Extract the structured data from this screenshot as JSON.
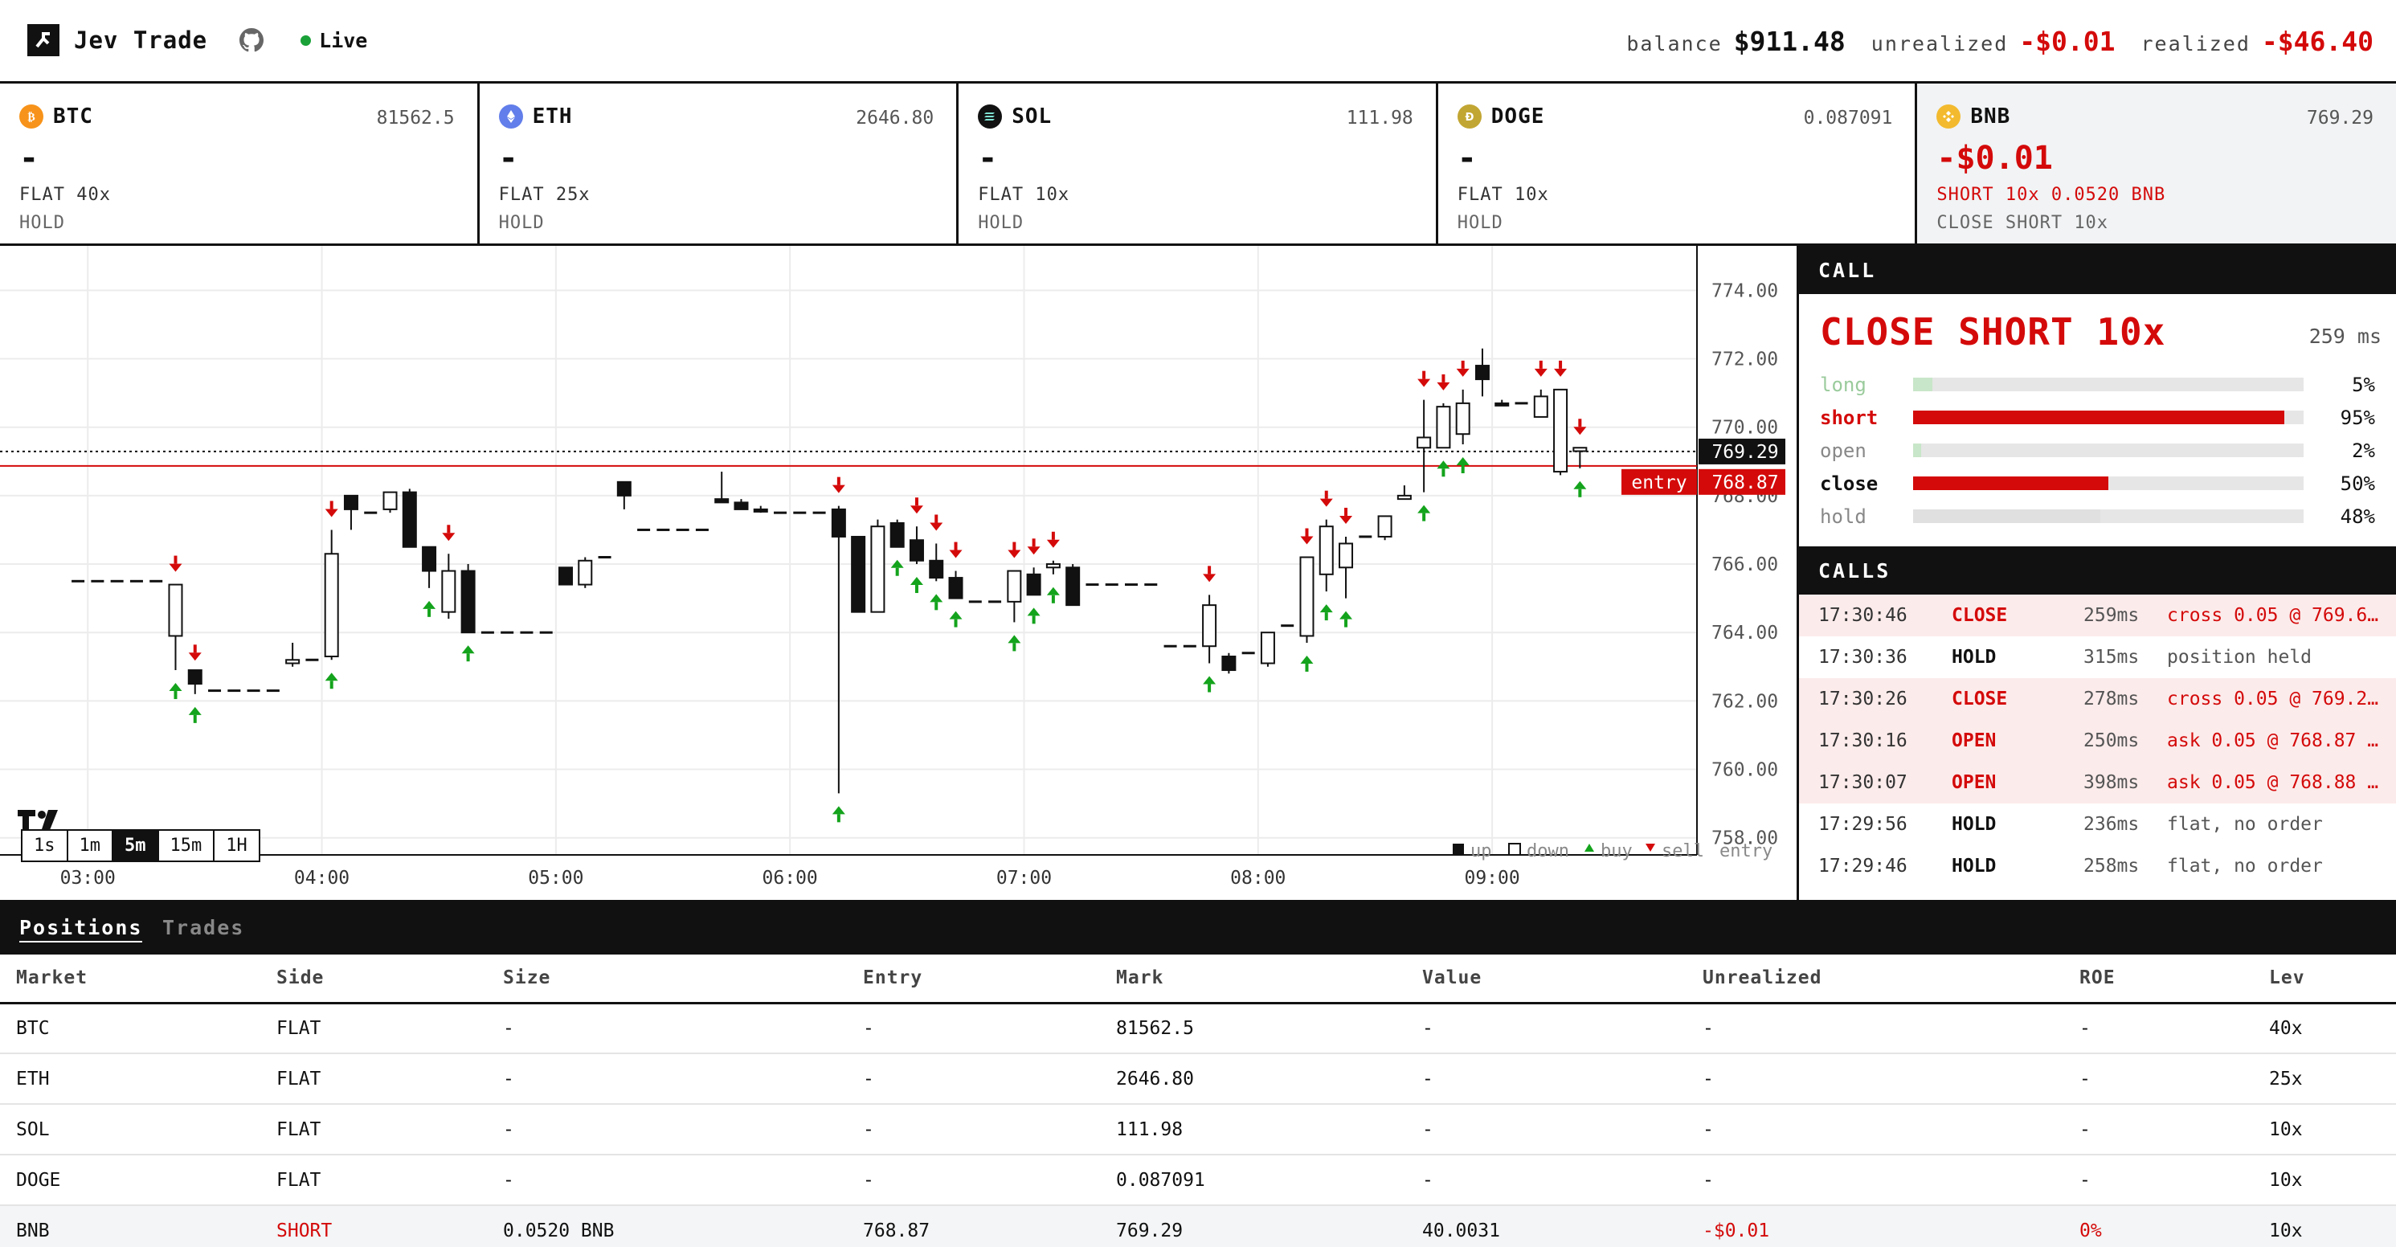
{
  "app": {
    "name": "Jev Trade",
    "status": "Live",
    "status_color": "#1aa138",
    "github_icon": "github-icon"
  },
  "header": {
    "balance_label": "balance",
    "balance_value": "$911.48",
    "unrealized_label": "unrealized",
    "unrealized_value": "-$0.01",
    "realized_label": "realized",
    "realized_value": "-$46.40"
  },
  "markets": [
    {
      "symbol": "BTC",
      "price": "81562.5",
      "pnl": "-",
      "position": "FLAT 40x",
      "action": "HOLD",
      "icon_color": "#f7931a",
      "icon": "bitcoin-icon"
    },
    {
      "symbol": "ETH",
      "price": "2646.80",
      "pnl": "-",
      "position": "FLAT 25x",
      "action": "HOLD",
      "icon_color": "#627eea",
      "icon": "ethereum-icon"
    },
    {
      "symbol": "SOL",
      "price": "111.98",
      "pnl": "-",
      "position": "FLAT 10x",
      "action": "HOLD",
      "icon_color": "#111111",
      "icon": "solana-icon"
    },
    {
      "symbol": "DOGE",
      "price": "0.087091",
      "pnl": "-",
      "position": "FLAT 10x",
      "action": "HOLD",
      "icon_color": "#c2a633",
      "icon": "dogecoin-icon"
    },
    {
      "symbol": "BNB",
      "price": "769.29",
      "pnl": "-$0.01",
      "position": "SHORT 10x 0.0520 BNB",
      "action": "CLOSE SHORT 10x",
      "icon_color": "#f3ba2f",
      "icon": "bnb-icon"
    }
  ],
  "chart": {
    "timeframes": [
      "1s",
      "1m",
      "5m",
      "15m",
      "1H"
    ],
    "active_timeframe": "5m",
    "legend": {
      "up": "up",
      "down": "down",
      "buy": "buy",
      "sell": "sell",
      "entry": "entry"
    },
    "current_price_label": "769.29",
    "entry_tag": "entry",
    "entry_price_label": "768.87"
  },
  "chart_data": {
    "type": "candlestick",
    "symbol": "BNB",
    "interval": "5m",
    "ylim": [
      757.5,
      775.3
    ],
    "y_ticks": [
      "758.00",
      "760.00",
      "762.00",
      "764.00",
      "766.00",
      "768.00",
      "770.00",
      "772.00",
      "774.00"
    ],
    "x_ticks": [
      "03:00",
      "04:00",
      "05:00",
      "06:00",
      "07:00",
      "08:00",
      "09:00"
    ],
    "last_price": 769.29,
    "entry_price": 768.87,
    "candles": [
      {
        "t": 1,
        "o": 765.5,
        "h": 765.5,
        "l": 765.5,
        "c": 765.5
      },
      {
        "t": 2,
        "o": 765.5,
        "h": 765.5,
        "l": 765.5,
        "c": 765.5
      },
      {
        "t": 3,
        "o": 765.5,
        "h": 765.5,
        "l": 765.5,
        "c": 765.5
      },
      {
        "t": 4,
        "o": 765.5,
        "h": 765.5,
        "l": 765.5,
        "c": 765.5
      },
      {
        "t": 5,
        "o": 765.5,
        "h": 765.5,
        "l": 765.5,
        "c": 765.5
      },
      {
        "t": 6,
        "o": 765.4,
        "h": 765.4,
        "l": 762.9,
        "c": 763.9,
        "sig": "both"
      },
      {
        "t": 7,
        "o": 762.5,
        "h": 762.8,
        "l": 762.2,
        "c": 762.9,
        "sig": "both"
      },
      {
        "t": 8,
        "o": 762.3,
        "h": 762.3,
        "l": 762.3,
        "c": 762.3
      },
      {
        "t": 9,
        "o": 762.3,
        "h": 762.3,
        "l": 762.3,
        "c": 762.3
      },
      {
        "t": 10,
        "o": 762.3,
        "h": 762.3,
        "l": 762.3,
        "c": 762.3
      },
      {
        "t": 11,
        "o": 762.3,
        "h": 762.3,
        "l": 762.3,
        "c": 762.3
      },
      {
        "t": 12,
        "o": 763.2,
        "h": 763.7,
        "l": 763.0,
        "c": 763.1
      },
      {
        "t": 13,
        "o": 763.2,
        "h": 763.2,
        "l": 763.2,
        "c": 763.2
      },
      {
        "t": 14,
        "o": 766.3,
        "h": 767.0,
        "l": 763.2,
        "c": 763.3,
        "sig": "both"
      },
      {
        "t": 15,
        "o": 767.6,
        "h": 767.9,
        "l": 767.0,
        "c": 768.0
      },
      {
        "t": 16,
        "o": 767.5,
        "h": 767.5,
        "l": 767.5,
        "c": 767.5
      },
      {
        "t": 17,
        "o": 768.1,
        "h": 768.1,
        "l": 767.5,
        "c": 767.6
      },
      {
        "t": 18,
        "o": 766.5,
        "h": 768.2,
        "l": 766.5,
        "c": 768.1
      },
      {
        "t": 19,
        "o": 765.8,
        "h": 766.4,
        "l": 765.3,
        "c": 766.5,
        "sig": "buy"
      },
      {
        "t": 20,
        "o": 765.8,
        "h": 766.3,
        "l": 764.4,
        "c": 764.6,
        "sig": "sell"
      },
      {
        "t": 21,
        "o": 764.0,
        "h": 766.0,
        "l": 764.0,
        "c": 765.8,
        "sig": "buy"
      },
      {
        "t": 22,
        "o": 764.0,
        "h": 764.0,
        "l": 764.0,
        "c": 764.0
      },
      {
        "t": 23,
        "o": 764.0,
        "h": 764.0,
        "l": 764.0,
        "c": 764.0
      },
      {
        "t": 24,
        "o": 764.0,
        "h": 764.0,
        "l": 764.0,
        "c": 764.0
      },
      {
        "t": 25,
        "o": 764.0,
        "h": 764.0,
        "l": 764.0,
        "c": 764.0
      },
      {
        "t": 26,
        "o": 765.4,
        "h": 765.9,
        "l": 765.4,
        "c": 765.9
      },
      {
        "t": 27,
        "o": 766.1,
        "h": 766.2,
        "l": 765.3,
        "c": 765.4
      },
      {
        "t": 28,
        "o": 766.2,
        "h": 766.2,
        "l": 766.2,
        "c": 766.2
      },
      {
        "t": 29,
        "o": 768.0,
        "h": 768.4,
        "l": 767.6,
        "c": 768.4
      },
      {
        "t": 30,
        "o": 767.0,
        "h": 767.0,
        "l": 767.0,
        "c": 767.0
      },
      {
        "t": 31,
        "o": 767.0,
        "h": 767.0,
        "l": 767.0,
        "c": 767.0
      },
      {
        "t": 32,
        "o": 767.0,
        "h": 767.0,
        "l": 767.0,
        "c": 767.0
      },
      {
        "t": 33,
        "o": 767.0,
        "h": 767.0,
        "l": 767.0,
        "c": 767.0
      },
      {
        "t": 34,
        "o": 767.8,
        "h": 768.7,
        "l": 767.8,
        "c": 767.9
      },
      {
        "t": 35,
        "o": 767.6,
        "h": 767.9,
        "l": 767.6,
        "c": 767.8
      },
      {
        "t": 36,
        "o": 767.6,
        "h": 767.7,
        "l": 767.5,
        "c": 767.6
      },
      {
        "t": 37,
        "o": 767.5,
        "h": 767.5,
        "l": 767.5,
        "c": 767.5
      },
      {
        "t": 38,
        "o": 767.5,
        "h": 767.5,
        "l": 767.5,
        "c": 767.5
      },
      {
        "t": 39,
        "o": 767.5,
        "h": 767.5,
        "l": 767.5,
        "c": 767.5
      },
      {
        "t": 40,
        "o": 766.8,
        "h": 767.7,
        "l": 759.3,
        "c": 767.6,
        "sig": "both"
      },
      {
        "t": 41,
        "o": 764.6,
        "h": 766.8,
        "l": 764.6,
        "c": 766.8
      },
      {
        "t": 42,
        "o": 767.1,
        "h": 767.3,
        "l": 764.6,
        "c": 764.6
      },
      {
        "t": 43,
        "o": 766.5,
        "h": 767.3,
        "l": 766.5,
        "c": 767.2,
        "sig": "buy"
      },
      {
        "t": 44,
        "o": 766.1,
        "h": 767.1,
        "l": 766.0,
        "c": 766.7,
        "sig": "both"
      },
      {
        "t": 45,
        "o": 765.6,
        "h": 766.6,
        "l": 765.5,
        "c": 766.1,
        "sig": "both"
      },
      {
        "t": 46,
        "o": 765.0,
        "h": 765.8,
        "l": 765.0,
        "c": 765.6,
        "sig": "both"
      },
      {
        "t": 47,
        "o": 764.9,
        "h": 764.9,
        "l": 764.9,
        "c": 764.9
      },
      {
        "t": 48,
        "o": 764.9,
        "h": 764.9,
        "l": 764.9,
        "c": 764.9
      },
      {
        "t": 49,
        "o": 765.8,
        "h": 765.8,
        "l": 764.3,
        "c": 764.9,
        "sig": "both"
      },
      {
        "t": 50,
        "o": 765.1,
        "h": 765.9,
        "l": 765.1,
        "c": 765.7,
        "sig": "both"
      },
      {
        "t": 51,
        "o": 766.0,
        "h": 766.1,
        "l": 765.7,
        "c": 765.9,
        "sig": "both"
      },
      {
        "t": 52,
        "o": 764.8,
        "h": 766.0,
        "l": 764.8,
        "c": 765.9
      },
      {
        "t": 53,
        "o": 765.4,
        "h": 765.4,
        "l": 765.4,
        "c": 765.4
      },
      {
        "t": 54,
        "o": 765.4,
        "h": 765.4,
        "l": 765.4,
        "c": 765.4
      },
      {
        "t": 55,
        "o": 765.4,
        "h": 765.4,
        "l": 765.4,
        "c": 765.4
      },
      {
        "t": 56,
        "o": 765.4,
        "h": 765.4,
        "l": 765.4,
        "c": 765.4
      },
      {
        "t": 57,
        "o": 763.6,
        "h": 763.6,
        "l": 763.6,
        "c": 763.6
      },
      {
        "t": 58,
        "o": 763.6,
        "h": 763.6,
        "l": 763.6,
        "c": 763.6
      },
      {
        "t": 59,
        "o": 764.8,
        "h": 765.1,
        "l": 763.1,
        "c": 763.6,
        "sig": "both"
      },
      {
        "t": 60,
        "o": 762.9,
        "h": 763.4,
        "l": 762.8,
        "c": 763.3
      },
      {
        "t": 61,
        "o": 763.4,
        "h": 763.4,
        "l": 763.4,
        "c": 763.4
      },
      {
        "t": 62,
        "o": 764.0,
        "h": 764.0,
        "l": 763.0,
        "c": 763.1
      },
      {
        "t": 63,
        "o": 764.2,
        "h": 764.2,
        "l": 764.2,
        "c": 764.2
      },
      {
        "t": 64,
        "o": 766.2,
        "h": 766.2,
        "l": 763.7,
        "c": 763.9,
        "sig": "both"
      },
      {
        "t": 65,
        "o": 767.1,
        "h": 767.3,
        "l": 765.2,
        "c": 765.7,
        "sig": "both"
      },
      {
        "t": 66,
        "o": 766.6,
        "h": 766.8,
        "l": 765.0,
        "c": 765.9,
        "sig": "both"
      },
      {
        "t": 67,
        "o": 766.8,
        "h": 766.8,
        "l": 766.8,
        "c": 766.8
      },
      {
        "t": 68,
        "o": 767.4,
        "h": 767.4,
        "l": 766.7,
        "c": 766.8
      },
      {
        "t": 69,
        "o": 768.0,
        "h": 768.3,
        "l": 767.9,
        "c": 767.9
      },
      {
        "t": 70,
        "o": 769.7,
        "h": 770.8,
        "l": 768.1,
        "c": 769.4,
        "sig": "both"
      },
      {
        "t": 71,
        "o": 770.6,
        "h": 770.7,
        "l": 769.4,
        "c": 769.4,
        "sig": "both"
      },
      {
        "t": 72,
        "o": 770.7,
        "h": 771.1,
        "l": 769.5,
        "c": 769.8,
        "sig": "both"
      },
      {
        "t": 73,
        "o": 771.4,
        "h": 772.3,
        "l": 770.9,
        "c": 771.8
      },
      {
        "t": 74,
        "o": 770.7,
        "h": 770.8,
        "l": 770.7,
        "c": 770.7
      },
      {
        "t": 75,
        "o": 770.7,
        "h": 770.7,
        "l": 770.7,
        "c": 770.7
      },
      {
        "t": 76,
        "o": 770.9,
        "h": 771.1,
        "l": 770.3,
        "c": 770.3,
        "sig": "sell"
      },
      {
        "t": 77,
        "o": 771.1,
        "h": 771.1,
        "l": 768.6,
        "c": 768.7,
        "sig": "sell"
      },
      {
        "t": 78,
        "o": 769.4,
        "h": 769.4,
        "l": 768.8,
        "c": 769.3,
        "sig": "both"
      }
    ]
  },
  "call": {
    "heading": "CALL",
    "decision": "CLOSE SHORT 10x",
    "latency": "259 ms",
    "probs": [
      {
        "label": "long",
        "value": 5,
        "display": "5%",
        "color": "#c8e6c9",
        "text_color": "#9acb9c",
        "bold": false
      },
      {
        "label": "short",
        "value": 95,
        "display": "95%",
        "color": "#d40a0a",
        "text_color": "#d40a0a",
        "bold": true
      },
      {
        "label": "open",
        "value": 2,
        "display": "2%",
        "color": "#c8e6c9",
        "text_color": "#888888",
        "bold": false
      },
      {
        "label": "close",
        "value": 50,
        "display": "50%",
        "color": "#d40a0a",
        "text_color": "#111111",
        "bold": true
      },
      {
        "label": "hold",
        "value": 48,
        "display": "48%",
        "color": "#e0e0e0",
        "text_color": "#888888",
        "bold": false
      }
    ]
  },
  "calls": {
    "heading": "CALLS",
    "rows": [
      {
        "time": "17:30:46",
        "action": "CLOSE",
        "latency": "259ms",
        "note": "cross 0.05 @ 769.6…",
        "highlight": true,
        "red": true
      },
      {
        "time": "17:30:36",
        "action": "HOLD",
        "latency": "315ms",
        "note": "position held",
        "highlight": false,
        "red": false
      },
      {
        "time": "17:30:26",
        "action": "CLOSE",
        "latency": "278ms",
        "note": "cross 0.05 @ 769.2…",
        "highlight": true,
        "red": true
      },
      {
        "time": "17:30:16",
        "action": "OPEN",
        "latency": "250ms",
        "note": "ask 0.05 @ 768.87 …",
        "highlight": true,
        "red": true
      },
      {
        "time": "17:30:07",
        "action": "OPEN",
        "latency": "398ms",
        "note": "ask 0.05 @ 768.88 …",
        "highlight": true,
        "red": true
      },
      {
        "time": "17:29:56",
        "action": "HOLD",
        "latency": "236ms",
        "note": "flat, no order",
        "highlight": false,
        "red": false
      },
      {
        "time": "17:29:46",
        "action": "HOLD",
        "latency": "258ms",
        "note": "flat, no order",
        "highlight": false,
        "red": false
      }
    ]
  },
  "bottom": {
    "tabs": [
      "Positions",
      "Trades"
    ],
    "active_tab": "Positions",
    "columns": [
      "Market",
      "Side",
      "Size",
      "Entry",
      "Mark",
      "Value",
      "Unrealized",
      "ROE",
      "Lev"
    ],
    "rows": [
      {
        "market": "BTC",
        "side": "FLAT",
        "size": "-",
        "entry": "-",
        "mark": "81562.5",
        "value": "-",
        "unrealized": "-",
        "roe": "-",
        "lev": "40x",
        "active": false
      },
      {
        "market": "ETH",
        "side": "FLAT",
        "size": "-",
        "entry": "-",
        "mark": "2646.80",
        "value": "-",
        "unrealized": "-",
        "roe": "-",
        "lev": "25x",
        "active": false
      },
      {
        "market": "SOL",
        "side": "FLAT",
        "size": "-",
        "entry": "-",
        "mark": "111.98",
        "value": "-",
        "unrealized": "-",
        "roe": "-",
        "lev": "10x",
        "active": false
      },
      {
        "market": "DOGE",
        "side": "FLAT",
        "size": "-",
        "entry": "-",
        "mark": "0.087091",
        "value": "-",
        "unrealized": "-",
        "roe": "-",
        "lev": "10x",
        "active": false
      },
      {
        "market": "BNB",
        "side": "SHORT",
        "size": "0.0520 BNB",
        "entry": "768.87",
        "mark": "769.29",
        "value": "40.0031",
        "unrealized": "-$0.01",
        "roe": "0%",
        "lev": "10x",
        "active": true
      }
    ]
  }
}
